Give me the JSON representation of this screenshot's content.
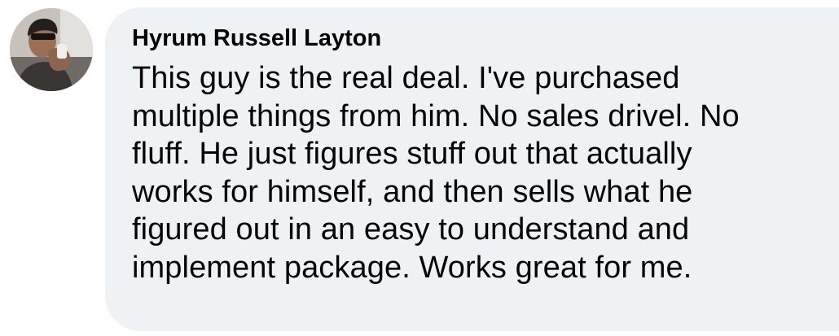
{
  "comment": {
    "author": "Hyrum Russell Layton",
    "avatar_icon": "user-avatar-photo",
    "lines": [
      "This guy is the real deal. I've purchased",
      "multiple things from him. No sales drivel. No",
      "fluff. He just figures stuff out that actually",
      "works for himself, and then sells what he",
      "figured out in an easy to understand and",
      "implement package. Works great for me."
    ]
  },
  "colors": {
    "bubble_background": "#eff2f5",
    "text": "#050505",
    "page_background": "#ffffff"
  }
}
